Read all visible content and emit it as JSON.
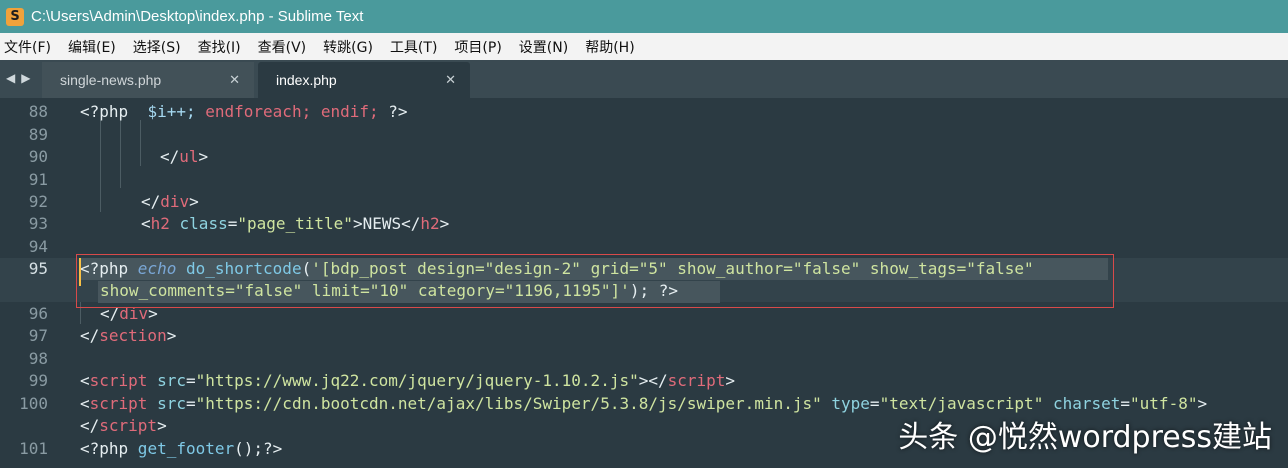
{
  "window": {
    "title": "C:\\Users\\Admin\\Desktop\\index.php - Sublime Text",
    "app_icon": "S"
  },
  "menu": [
    "文件(F)",
    "编辑(E)",
    "选择(S)",
    "查找(I)",
    "查看(V)",
    "转跳(G)",
    "工具(T)",
    "项目(P)",
    "设置(N)",
    "帮助(H)"
  ],
  "tabs": [
    {
      "label": "single-news.php",
      "close": "✕",
      "active": false
    },
    {
      "label": "index.php",
      "close": "✕",
      "active": true
    }
  ],
  "lines": [
    {
      "num": "88"
    },
    {
      "num": "89"
    },
    {
      "num": "90"
    },
    {
      "num": "91"
    },
    {
      "num": "92"
    },
    {
      "num": "93"
    },
    {
      "num": "94"
    },
    {
      "num": "95"
    },
    {
      "num": "96"
    },
    {
      "num": "97"
    },
    {
      "num": "98"
    },
    {
      "num": "99"
    },
    {
      "num": "100"
    },
    {
      "num": "101"
    }
  ],
  "code": {
    "l88": {
      "a": "<?php",
      "b": "  $i++;",
      "c": " endforeach; endif;",
      "d": " ?>"
    },
    "l90": {
      "a": "</",
      "b": "ul",
      "c": ">"
    },
    "l92": {
      "a": "</",
      "b": "div",
      "c": ">"
    },
    "l93": {
      "a": "<",
      "b": "h2",
      "c": " class",
      "d": "=",
      "e": "\"page_title\"",
      "f": ">NEWS</",
      "g": "h2",
      "h": ">"
    },
    "l95a": {
      "a": "<?php",
      "b": " echo",
      "c": " do_shortcode",
      "d": "(",
      "e": "'[bdp_post design=\"design-2\" grid=\"5\" show_author=\"false\" show_tags=\"false\""
    },
    "l95b": {
      "a": "show_comments=\"false\" limit=\"10\" category=\"1196,1195\"]'",
      "b": ");",
      "c": " ?>"
    },
    "l96": {
      "a": "</",
      "b": "div",
      "c": ">"
    },
    "l97": {
      "a": "</",
      "b": "section",
      "c": ">"
    },
    "l99": {
      "a": "<",
      "b": "script",
      "c": " src",
      "d": "=",
      "e": "\"https://www.jq22.com/jquery/jquery-1.10.2.js\"",
      "f": "></",
      "g": "script",
      "h": ">"
    },
    "l100a": {
      "a": "<",
      "b": "script",
      "c": " src",
      "d": "=",
      "e": "\"https://cdn.bootcdn.net/ajax/libs/Swiper/5.3.8/js/swiper.min.js\"",
      "f": " type",
      "g": "=",
      "h": "\"text/javascript\"",
      "i": " charset",
      "j": "=",
      "k": "\"utf-8\"",
      "l": ">"
    },
    "l100b": {
      "a": "</",
      "b": "script",
      "c": ">"
    },
    "l101": {
      "a": "<?php",
      "b": " get_footer",
      "c": "();?>"
    }
  },
  "watermark": "头条 @悦然wordpress建站",
  "colors": {
    "titlebar": "#4a9a9c",
    "editor_bg": "#2b3a42",
    "tag": "#e06b7a",
    "string": "#cfe4a0",
    "selection_border": "#d84a4a"
  }
}
